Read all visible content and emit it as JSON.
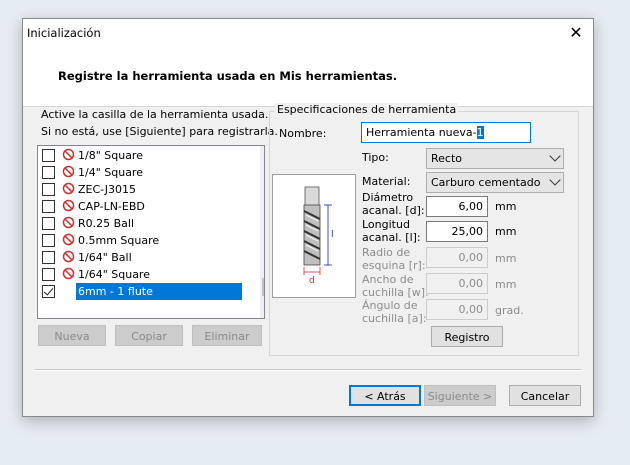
{
  "window": {
    "title": "Inicialización",
    "close_glyph": "✕"
  },
  "header": {
    "text": "Registre la herramienta usada en Mis herramientas."
  },
  "intro": {
    "line1": "Active la casilla de la herramienta usada.",
    "line2": "Si no está, use [Siguiente] para registrarla."
  },
  "tool_list": {
    "items": [
      {
        "label": "1/8\" Square",
        "checked": false,
        "icon": "prohibited-icon"
      },
      {
        "label": "1/4\" Square",
        "checked": false,
        "icon": "prohibited-icon"
      },
      {
        "label": "ZEC-J3015",
        "checked": false,
        "icon": "prohibited-icon"
      },
      {
        "label": "CAP-LN-EBD",
        "checked": false,
        "icon": "prohibited-icon"
      },
      {
        "label": "R0.25 Ball",
        "checked": false,
        "icon": "prohibited-icon"
      },
      {
        "label": "0.5mm Square",
        "checked": false,
        "icon": "prohibited-icon"
      },
      {
        "label": "1/64\" Ball",
        "checked": false,
        "icon": "prohibited-icon"
      },
      {
        "label": "1/64\" Square",
        "checked": false,
        "icon": "prohibited-icon"
      },
      {
        "label": "6mm - 1 flute",
        "checked": true,
        "selected": true
      }
    ],
    "scroll_up": "︿",
    "scroll_down": "﹀"
  },
  "list_buttons": {
    "new": "Nueva",
    "copy": "Copiar",
    "delete": "Eliminar"
  },
  "spec": {
    "group_title": "Especificaciones de herramienta",
    "name_label": "Nombre:",
    "name_value": "Herramienta nueva-",
    "name_value_selected": "1",
    "type_label": "Tipo:",
    "type_value": "Recto",
    "material_label": "Material:",
    "material_value": "Carburo cementado",
    "diameter_label_1": "Diámetro",
    "diameter_label_2": "acanal. [d]:",
    "diameter_value": "6,00",
    "diameter_unit": "mm",
    "length_label_1": "Longitud",
    "length_label_2": "acanal. [l]:",
    "length_value": "25,00",
    "length_unit": "mm",
    "radius_label_1": "Radio de",
    "radius_label_2": "esquina [r]:",
    "radius_value": "0,00",
    "radius_unit": "mm",
    "width_label_1": "Ancho de",
    "width_label_2": "cuchilla [w]:",
    "width_value": "0,00",
    "width_unit": "mm",
    "angle_label_1": "Ángulo de",
    "angle_label_2": "cuchilla [a]:",
    "angle_value": "0,00",
    "angle_unit": "grad.",
    "register_button": "Registro",
    "diagram_l": "l",
    "diagram_d": "d"
  },
  "footer": {
    "back": "< Atrás",
    "next": "Siguiente >",
    "cancel": "Cancelar"
  },
  "colors": {
    "accent": "#0078d7",
    "prohibited": "#d0312d",
    "dimension": "#2020b0"
  }
}
